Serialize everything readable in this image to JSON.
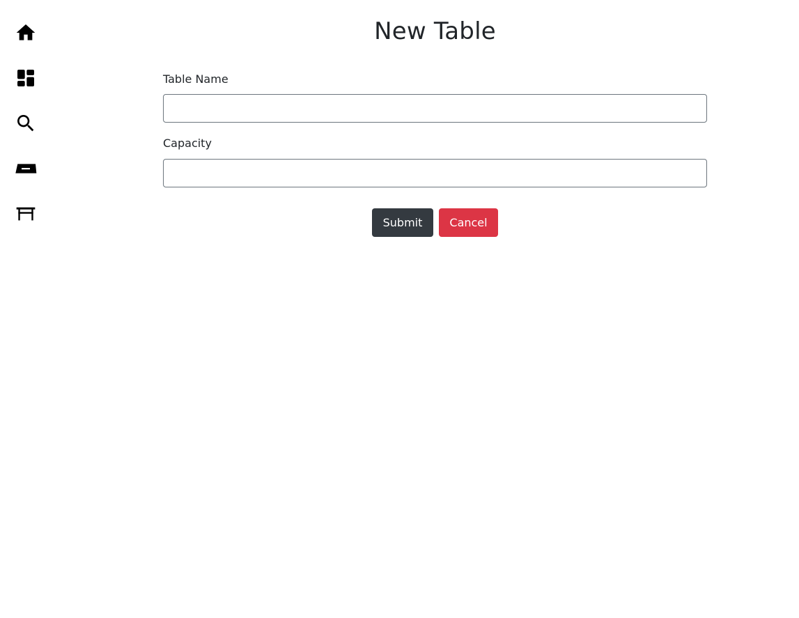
{
  "sidebar": {
    "items": [
      {
        "icon": "home-icon"
      },
      {
        "icon": "dashboard-icon"
      },
      {
        "icon": "search-icon"
      },
      {
        "icon": "reservation-icon"
      },
      {
        "icon": "table-icon"
      }
    ]
  },
  "form": {
    "title": "New Table",
    "table_name": {
      "label": "Table Name",
      "value": "",
      "placeholder": ""
    },
    "capacity": {
      "label": "Capacity",
      "value": "",
      "placeholder": ""
    },
    "submit_label": "Submit",
    "cancel_label": "Cancel"
  },
  "colors": {
    "submit": "#343a40",
    "cancel": "#dc3545",
    "text": "#212529",
    "input_border": "#6c757d"
  }
}
